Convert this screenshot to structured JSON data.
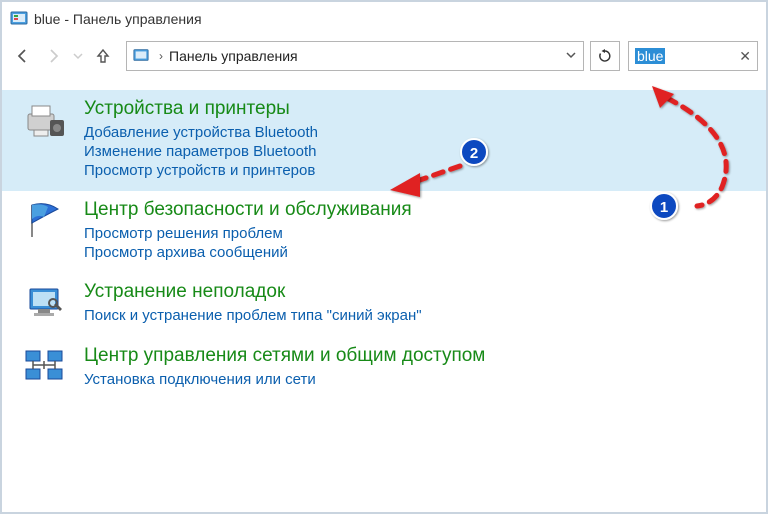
{
  "window": {
    "title": "blue - Панель управления"
  },
  "toolbar": {
    "address": "Панель управления",
    "search_value": "blue"
  },
  "categories": [
    {
      "title": "Устройства и принтеры",
      "links": [
        "Добавление устройства Bluetooth",
        "Изменение параметров Bluetooth",
        "Просмотр устройств и принтеров"
      ],
      "highlighted": true,
      "icon": "devices-printers"
    },
    {
      "title": "Центр безопасности и обслуживания",
      "links": [
        "Просмотр решения проблем",
        "Просмотр архива сообщений"
      ],
      "highlighted": false,
      "icon": "security-flag"
    },
    {
      "title": "Устранение неполадок",
      "links": [
        "Поиск и устранение проблем типа \"синий экран\""
      ],
      "highlighted": false,
      "icon": "troubleshoot"
    },
    {
      "title": "Центр управления сетями и общим доступом",
      "links": [
        "Установка подключения или сети"
      ],
      "highlighted": false,
      "icon": "network-sharing"
    }
  ],
  "annotations": {
    "badge1": "1",
    "badge2": "2"
  }
}
